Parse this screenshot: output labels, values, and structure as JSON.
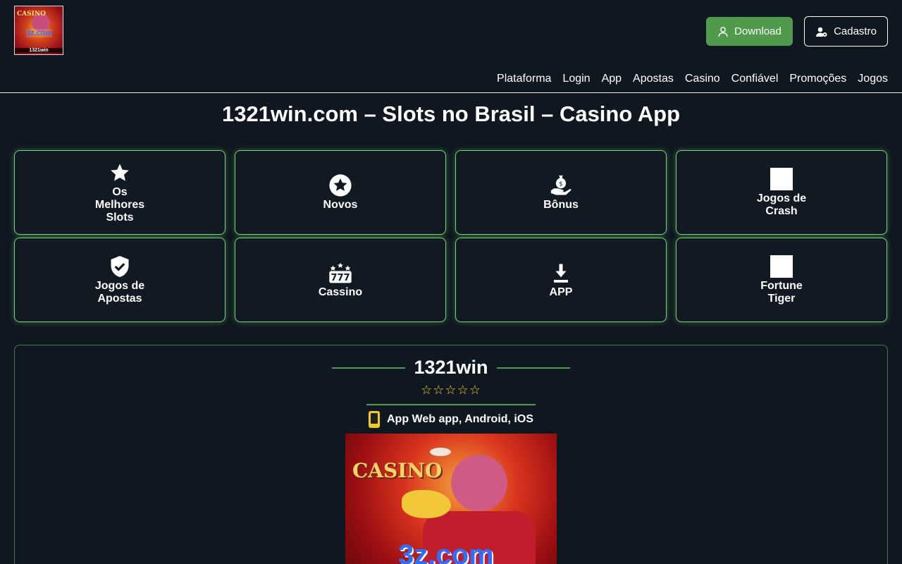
{
  "header": {
    "logo": {
      "top_text": "CASINO",
      "mid_text": "3z.com",
      "bottom_text": "1321win"
    },
    "download_label": "Download",
    "cadastro_label": "Cadastro"
  },
  "nav": [
    "Plataforma",
    "Login",
    "App",
    "Apostas",
    "Casino",
    "Confiável",
    "Promoções",
    "Jogos"
  ],
  "title": "1321win.com – Slots no Brasil – Casino App",
  "cards": [
    {
      "label": "Os Melhores Slots",
      "icon": "star-icon"
    },
    {
      "label": "Novos",
      "icon": "star-circle-icon"
    },
    {
      "label": "Bônus",
      "icon": "money-bag-hand-icon"
    },
    {
      "label": "Jogos de Crash",
      "icon": "image-placeholder-icon"
    },
    {
      "label": "Jogos de Apostas",
      "icon": "shield-check-icon"
    },
    {
      "label": "Cassino",
      "icon": "slot-777-icon"
    },
    {
      "label": "APP",
      "icon": "download-icon"
    },
    {
      "label": "Fortune Tiger",
      "icon": "image-placeholder-icon"
    }
  ],
  "brand": {
    "name": "1321win",
    "stars": "☆☆☆☆☆",
    "apps": "App Web app, Android, iOS"
  },
  "hero": {
    "casino": "CASINO",
    "site": "3z.com"
  },
  "colors": {
    "accent_green": "#4f9a4b",
    "background": "#0f1720",
    "star_yellow": "#f1cb1f"
  }
}
